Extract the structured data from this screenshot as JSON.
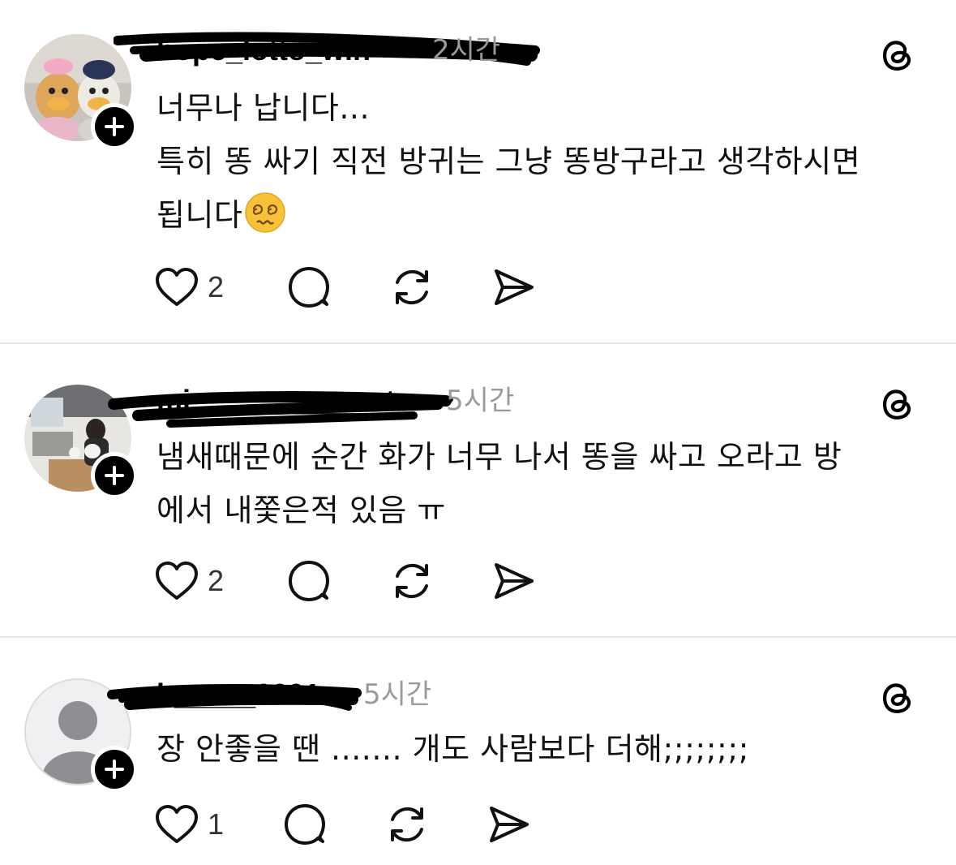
{
  "posts": [
    {
      "username": "hope_lotto_win",
      "time": "2시간",
      "lines": [
        "너무나 납니다...",
        "특히 똥 싸기 직전 방귀는 그냥 똥방구라고 생각하시면",
        "됩니다"
      ],
      "emoji": "dizzy-face",
      "likes": "2"
    },
    {
      "username": "mi___________ato",
      "time": "5시간",
      "lines": [
        "냄새때문에 순간 화가 너무 나서 똥을 싸고 오라고 방",
        "에서 내쫓은적 있음 ㅠ"
      ],
      "likes": "2"
    },
    {
      "username": "h_____0001",
      "time": "5시간",
      "lines": [
        "장 안좋을 땐 ....... 개도 사람보다 더해;;;;;;;;"
      ],
      "likes": "1"
    }
  ],
  "colors": {
    "divider": "#e6e6e6",
    "timestamp": "#9a9a9a",
    "text": "#111111"
  }
}
